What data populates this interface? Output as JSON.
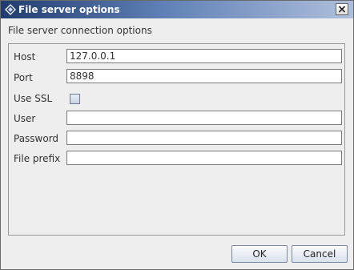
{
  "window": {
    "title": "File server options",
    "title_icon": "diamond-app-icon",
    "close_icon": "close-icon"
  },
  "dialog": {
    "subtitle": "File server connection options"
  },
  "form": {
    "host_label": "Host",
    "host_value": "127.0.0.1",
    "port_label": "Port",
    "port_value": "8898",
    "ssl_label": "Use SSL",
    "ssl_checked": false,
    "user_label": "User",
    "user_value": "",
    "password_label": "Password",
    "password_value": "",
    "prefix_label": "File prefix",
    "prefix_value": ""
  },
  "buttons": {
    "ok_label": "OK",
    "cancel_label": "Cancel"
  },
  "colors": {
    "titlebar_start": "#203c6e",
    "titlebar_end": "#aebfdc",
    "background": "#eeeeee"
  }
}
